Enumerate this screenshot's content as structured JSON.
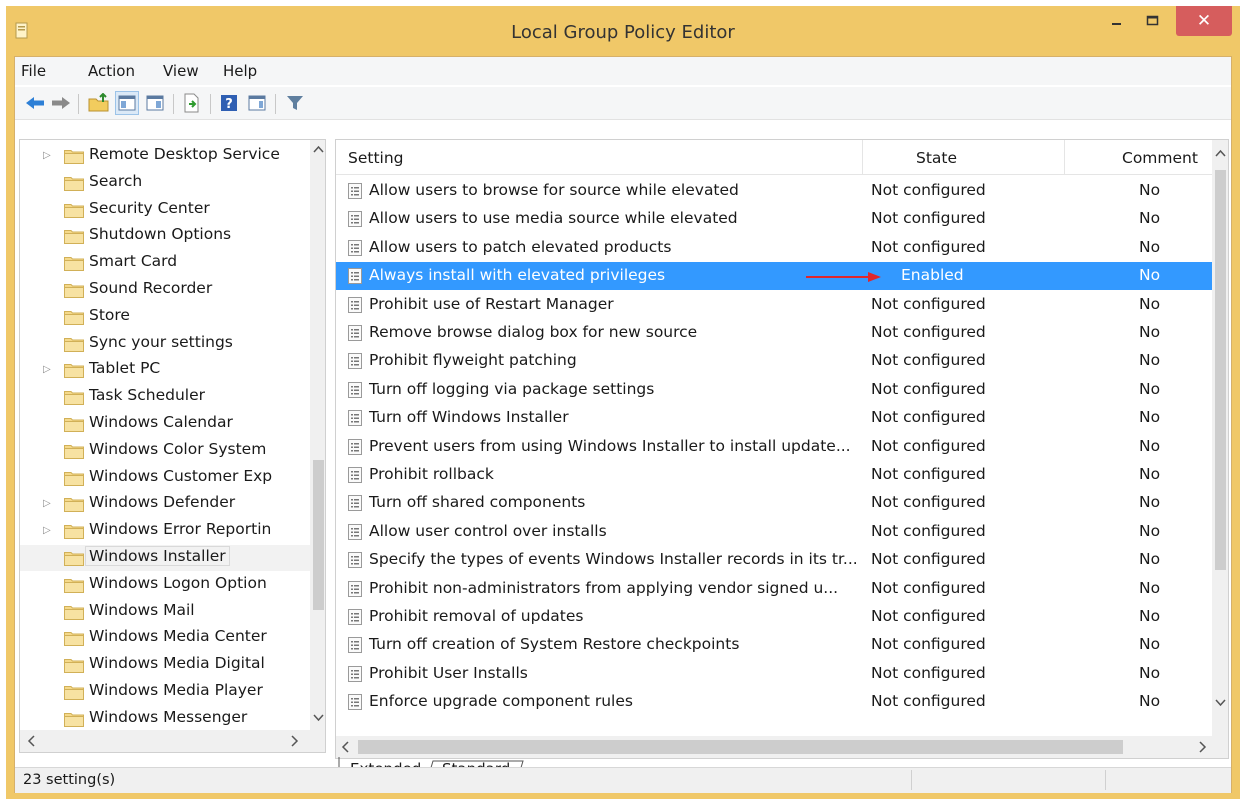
{
  "window": {
    "title": "Local Group Policy Editor",
    "close_glyph": "✕"
  },
  "menu": [
    "File",
    "Action",
    "View",
    "Help"
  ],
  "toolbar": {
    "icons": [
      "back-icon",
      "forward-icon",
      "up-folder-icon",
      "show-hide-tree-icon",
      "export-list-icon",
      "help-icon",
      "show-hide-action-pane-icon",
      "filter-icon"
    ]
  },
  "tree": {
    "items": [
      {
        "label": "Remote Desktop Service",
        "expandable": true
      },
      {
        "label": "Search",
        "expandable": false
      },
      {
        "label": "Security Center",
        "expandable": false
      },
      {
        "label": "Shutdown Options",
        "expandable": false
      },
      {
        "label": "Smart Card",
        "expandable": false
      },
      {
        "label": "Sound Recorder",
        "expandable": false
      },
      {
        "label": "Store",
        "expandable": false
      },
      {
        "label": "Sync your settings",
        "expandable": false
      },
      {
        "label": "Tablet PC",
        "expandable": true
      },
      {
        "label": "Task Scheduler",
        "expandable": false
      },
      {
        "label": "Windows Calendar",
        "expandable": false
      },
      {
        "label": "Windows Color System",
        "expandable": false
      },
      {
        "label": "Windows Customer Exp",
        "expandable": false
      },
      {
        "label": "Windows Defender",
        "expandable": true
      },
      {
        "label": "Windows Error Reportin",
        "expandable": true
      },
      {
        "label": "Windows Installer",
        "expandable": false,
        "selected": true
      },
      {
        "label": "Windows Logon Option",
        "expandable": false
      },
      {
        "label": "Windows Mail",
        "expandable": false
      },
      {
        "label": "Windows Media Center",
        "expandable": false
      },
      {
        "label": "Windows Media Digital",
        "expandable": false
      },
      {
        "label": "Windows Media Player",
        "expandable": false
      },
      {
        "label": "Windows Messenger",
        "expandable": false
      }
    ]
  },
  "table": {
    "columns": [
      "Setting",
      "State",
      "Comment"
    ],
    "rows": [
      {
        "setting": "Allow users to browse for source while elevated",
        "state": "Not configured",
        "comment": "No"
      },
      {
        "setting": "Allow users to use media source while elevated",
        "state": "Not configured",
        "comment": "No"
      },
      {
        "setting": "Allow users to patch elevated products",
        "state": "Not configured",
        "comment": "No"
      },
      {
        "setting": "Always install with elevated privileges",
        "state": "Enabled",
        "comment": "No",
        "selected": true
      },
      {
        "setting": "Prohibit use of Restart Manager",
        "state": "Not configured",
        "comment": "No"
      },
      {
        "setting": "Remove browse dialog box for new source",
        "state": "Not configured",
        "comment": "No"
      },
      {
        "setting": "Prohibit flyweight patching",
        "state": "Not configured",
        "comment": "No"
      },
      {
        "setting": "Turn off logging via package settings",
        "state": "Not configured",
        "comment": "No"
      },
      {
        "setting": "Turn off Windows Installer",
        "state": "Not configured",
        "comment": "No"
      },
      {
        "setting": "Prevent users from using Windows Installer to install update...",
        "state": "Not configured",
        "comment": "No"
      },
      {
        "setting": "Prohibit rollback",
        "state": "Not configured",
        "comment": "No"
      },
      {
        "setting": "Turn off shared components",
        "state": "Not configured",
        "comment": "No"
      },
      {
        "setting": "Allow user control over installs",
        "state": "Not configured",
        "comment": "No"
      },
      {
        "setting": "Specify the types of events Windows Installer records in its tr...",
        "state": "Not configured",
        "comment": "No"
      },
      {
        "setting": "Prohibit non-administrators from applying vendor signed u...",
        "state": "Not configured",
        "comment": "No"
      },
      {
        "setting": "Prohibit removal of updates",
        "state": "Not configured",
        "comment": "No"
      },
      {
        "setting": "Turn off creation of System Restore checkpoints",
        "state": "Not configured",
        "comment": "No"
      },
      {
        "setting": "Prohibit User Installs",
        "state": "Not configured",
        "comment": "No"
      },
      {
        "setting": "Enforce upgrade component rules",
        "state": "Not configured",
        "comment": "No"
      }
    ]
  },
  "tabs": [
    {
      "label": "Extended",
      "active": false
    },
    {
      "label": "Standard",
      "active": true
    }
  ],
  "status": {
    "text": "23 setting(s)"
  },
  "colors": {
    "title_bar": "#f0c868",
    "selection": "#3399ff",
    "close_button": "#d65d5d",
    "annotation_arrow": "#e0262b",
    "folder": "#f5d98a"
  }
}
